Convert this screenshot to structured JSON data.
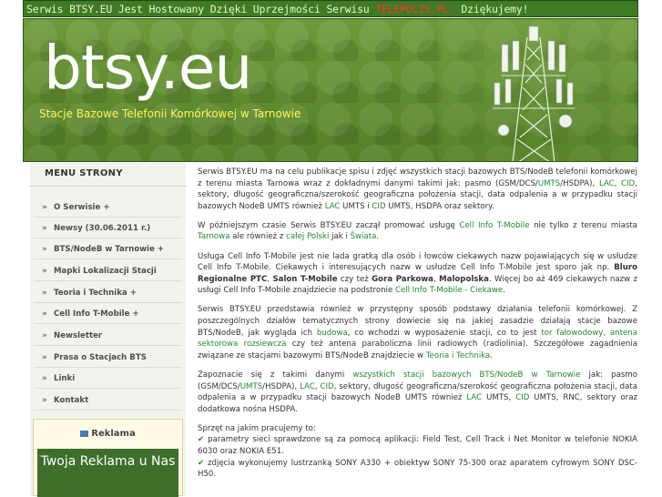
{
  "topbar": {
    "text_before": "Serwis BTSY.EU Jest Hostowany Dzięki Uprzejmości Serwisu ",
    "link": "TELEPOLIS.PL.",
    "text_after": " Dziękujemy!"
  },
  "banner": {
    "title": "btsy.eu",
    "subtitle": "Stacje Bazowe Telefonii Komórkowej w Tarnowie"
  },
  "menu": {
    "heading": "MENU STRONY",
    "items": [
      {
        "label": "O Serwisie +"
      },
      {
        "label": "Newsy (30.06.2011 r.)"
      },
      {
        "label": "BTS/NodeB w Tarnowie +"
      },
      {
        "label": "Mapki Lokalizacji Stacji"
      },
      {
        "label": "Teoria i Technika +"
      },
      {
        "label": "Cell Info T-Mobile +"
      },
      {
        "label": "Newsletter"
      },
      {
        "label": "Prasa o Stacjach BTS"
      },
      {
        "label": "Linki"
      },
      {
        "label": "Kontakt"
      }
    ]
  },
  "ad": {
    "heading": "Reklama",
    "banner_text": "Twoja Reklama u Nas"
  },
  "p1": {
    "t1": "Serwis BTSY.EU ma na celu publikacje spisu i zdjęć wszystkich stacji bazowych BTS/NodeB telefonii komórkowej z terenu miasta Tarnowa wraz z dokładnymi danymi takimi jak: pasmo (GSM/DCS/",
    "l1": "UMTS",
    "t2": "/HSDPA), ",
    "l2": "LAC",
    "t3": ", ",
    "l3": "CID",
    "t4": ", sektory, długość geograficzna/szerokość geograficzna położenia stacji, data odpalenia a w przypadku stacji bazowych NodeB UMTS również ",
    "l4": "LAC",
    "t5": " UMTS i ",
    "l5": "CID",
    "t6": " UMTS, HSDPA oraz sektory."
  },
  "p2": {
    "t1": "W późniejszym czasie Serwis BTSY.EU zaczął promować usługę ",
    "l1": "Cell Info T-Mobile",
    "t2": " nie tylko z terenu miasta ",
    "l2": "Tarnowa",
    "t3": " ale również z ",
    "l3": "całej Polski",
    "t4": " jak i ",
    "l4": "Świata",
    "t5": "."
  },
  "p3": {
    "t1": "Usługa Cell Info T-Mobile jest nie lada gratką dla osób i łowców ciekawych nazw pojawiających się w usłudze Cell Info T-Mobile. Ciekawych i interesujących nazw w usłudze Cell Info T-Mobile jest sporo jak np. ",
    "b1": "Bluro Regionalne PTC",
    "t2": ", ",
    "b2": "Salon T-Mobile",
    "t3": " czy też ",
    "b3": "Gora Parkowa",
    "t4": ", ",
    "b4": "Malopolska",
    "t5": ". Więcej bo aż 469 ciekawych nazw z usługi Cell Info T-Mobile znajdziecie na podstronie ",
    "l1": "Cell Info T-Mobile - Ciekawe",
    "t6": "."
  },
  "p4": {
    "t1": "Serwis BTSY.EU przedstawia również w przystępny sposób podstawy działania telefonii komórkowej. Z poszczególnych działów tematycznych strony dowiecie się na jakiej zasadzie działają stacje bazowe BTS/NodeB, jak wygląda ich ",
    "l1": "budowa",
    "t2": ", co wchodzi w wyposażenie stacji, co to jest ",
    "l2": "tor fałowodowy, antena sektorowa rozsiewcza",
    "t3": " czy też antena paraboliczna linii radiowych (radiolinia). Szczegółowe zagadnienia związane ze stacjami bazowymi BTS/NodeB znajdziecie w ",
    "l3": "Teoria i Technika",
    "t4": "."
  },
  "p5": {
    "t1": "Zapoznacie się z takimi danymi ",
    "l1": "wszystkich stacji bazowych BTS/NodeB w Tarnowie",
    "t2": " jak: pasmo (GSM/DCS/",
    "l2": "UMTS",
    "t3": "/HSDPA), ",
    "l3": "LAC",
    "t4": ", ",
    "l4": "CID",
    "t5": ", sektory, długość geograficzna/szerokość geograficzna położenia stacji, data odpalenia a w przypadku stacji bazowych NodeB UMTS również ",
    "l5": "LAC",
    "t6": " UMTS, ",
    "l6": "CID",
    "t7": " UMTS, RNC, sektory oraz dodatkowa nośna HSDPA."
  },
  "p6": {
    "intro": "Sprzęt na jakim pracujemy to:",
    "line1": " parametry sieci sprawdzone są za pomocą aplikacji: Field Test, Cell Track i Net Monitor w telefonie NOKIA 6030 oraz NOKIA E51.",
    "line2": " zdjęcia wykonujemy lustrzanką SONY A330 + obiektyw SONY 75-300 oraz aparatem cyfrowym SONY DSC-H50."
  }
}
